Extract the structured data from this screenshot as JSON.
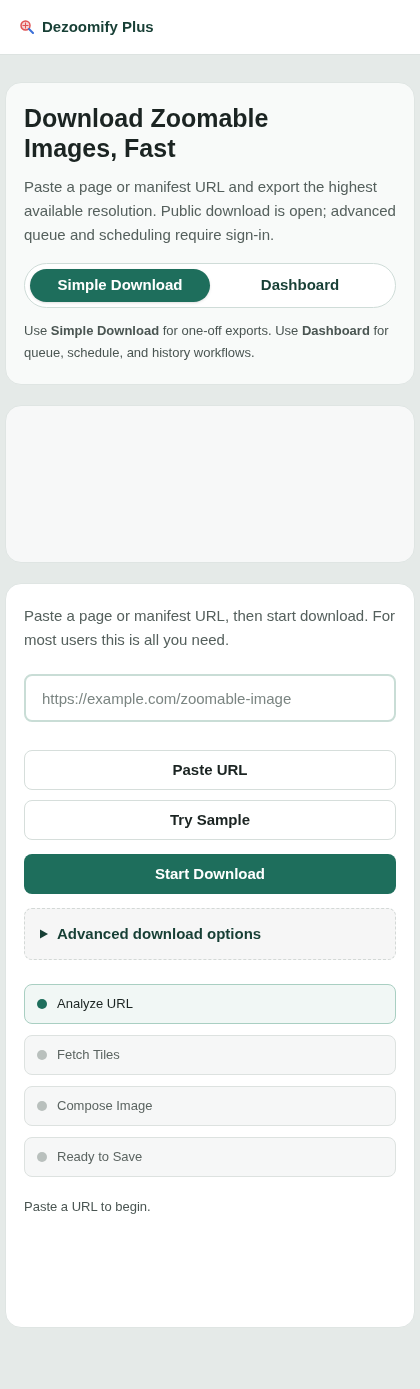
{
  "header": {
    "brand": "Dezoomify Plus"
  },
  "hero": {
    "title": "Download Zoomable Images, Fast",
    "description": "Paste a page or manifest URL and export the highest available resolution. Public download is open; advanced queue and scheduling require sign-in.",
    "tabs": [
      {
        "label": "Simple Download",
        "selected": true
      },
      {
        "label": "Dashboard",
        "selected": false
      }
    ],
    "hint": "Use **Simple Download** for one-off exports. Use **Dashboard** for queue, schedule, and history workflows."
  },
  "download": {
    "intro": "Paste a page or manifest URL, then start download. For most users this is all you need.",
    "url_field": {
      "placeholder": "https://example.com/zoomable-image"
    },
    "buttons": [
      {
        "label": "Paste URL",
        "kind": "secondary"
      },
      {
        "label": "Try Sample",
        "kind": "secondary"
      },
      {
        "label": "Start Download",
        "kind": "primary"
      }
    ],
    "advanced": {
      "label": "Advanced download options",
      "expanded": false
    },
    "steps": [
      {
        "label": "Analyze URL",
        "active": true
      },
      {
        "label": "Fetch Tiles",
        "active": false
      },
      {
        "label": "Compose Image",
        "active": false
      },
      {
        "label": "Ready to Save",
        "active": false
      }
    ],
    "status": "Paste a URL to begin."
  }
}
